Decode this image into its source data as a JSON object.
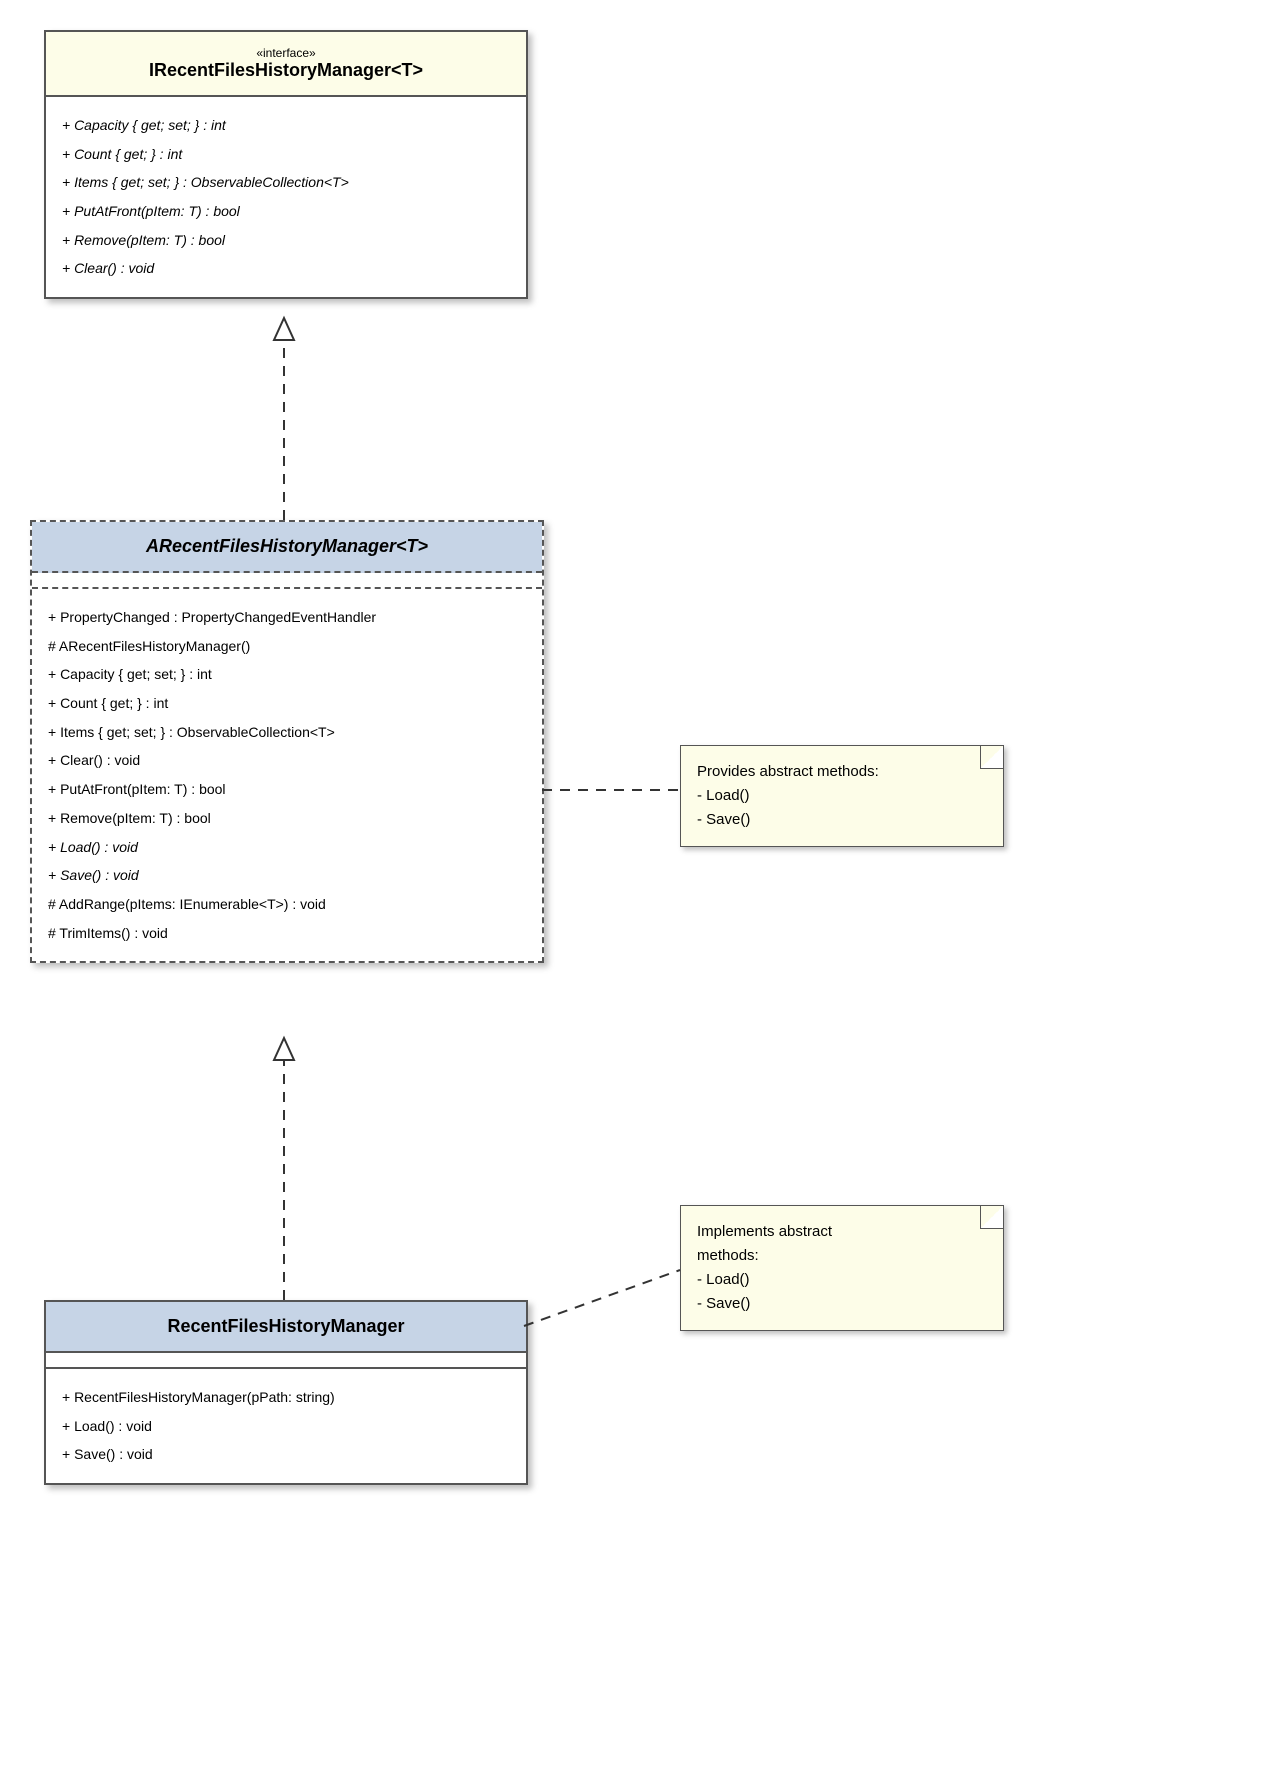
{
  "interface": {
    "stereotype": "«interface»",
    "title": "IRecentFilesHistoryManager<T>",
    "members": [
      "+ Capacity { get; set; } : int",
      "+ Count { get; } : int",
      "+ Items { get; set; } : ObservableCollection<T>",
      "+ PutAtFront(pItem: T) : bool",
      "+ Remove(pItem: T) : bool",
      "+ Clear() : void"
    ]
  },
  "abstract": {
    "title": "ARecentFilesHistoryManager<T>",
    "members": [
      {
        "text": "+ PropertyChanged : PropertyChangedEventHandler",
        "italic": false
      },
      {
        "text": "# ARecentFilesHistoryManager()",
        "italic": false
      },
      {
        "text": "+ Capacity { get; set; } : int",
        "italic": false
      },
      {
        "text": "+ Count { get; } : int",
        "italic": false
      },
      {
        "text": "+ Items { get; set; } : ObservableCollection<T>",
        "italic": false
      },
      {
        "text": "+ Clear() : void",
        "italic": false
      },
      {
        "text": "+ PutAtFront(pItem: T) : bool",
        "italic": false
      },
      {
        "text": "+ Remove(pItem: T) : bool",
        "italic": false
      },
      {
        "text": "+ Load() : void",
        "italic": true
      },
      {
        "text": "+ Save() : void",
        "italic": true
      },
      {
        "text": "# AddRange(pItems: IEnumerable<T>) : void",
        "italic": false
      },
      {
        "text": "# TrimItems() : void",
        "italic": false
      }
    ]
  },
  "concrete": {
    "title": "RecentFilesHistoryManager",
    "members": [
      "+ RecentFilesHistoryManager(pPath: string)",
      "+ Load() : void",
      "+ Save() : void"
    ]
  },
  "note1": {
    "line1": "Provides abstract methods:",
    "line2": "- Load()",
    "line3": "- Save()"
  },
  "note2": {
    "line1": "Implements abstract",
    "line2": "methods:",
    "line3": "- Load()",
    "line4": "- Save()"
  }
}
